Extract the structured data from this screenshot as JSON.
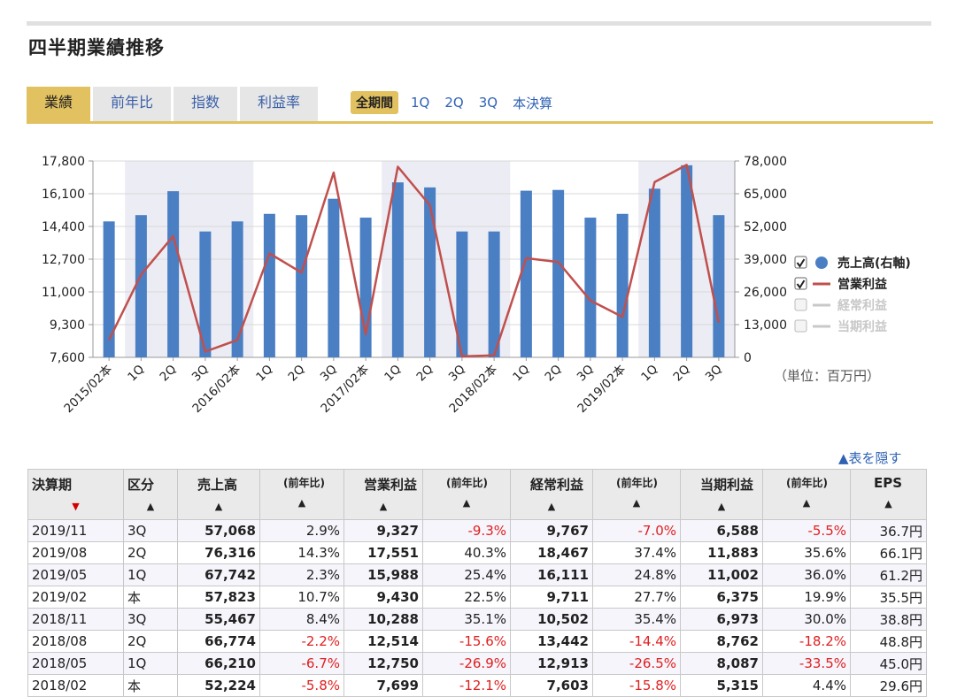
{
  "title": "四半期業績推移",
  "tabs": [
    {
      "label": "業績",
      "active": true
    },
    {
      "label": "前年比",
      "active": false
    },
    {
      "label": "指数",
      "active": false
    },
    {
      "label": "利益率",
      "active": false
    }
  ],
  "periods": [
    {
      "label": "全期間",
      "active": true
    },
    {
      "label": "1Q",
      "active": false
    },
    {
      "label": "2Q",
      "active": false
    },
    {
      "label": "3Q",
      "active": false
    },
    {
      "label": "本決算",
      "active": false
    }
  ],
  "colors": {
    "bar": "#4a7fc4",
    "line": "#c0504d",
    "band": "#ececf4",
    "gold": "#e2c160",
    "disabled": "#c8c8c8"
  },
  "chart_data": {
    "type": "bar",
    "categories": [
      "2015/02本",
      "1Q",
      "2Q",
      "3Q",
      "2016/02本",
      "1Q",
      "2Q",
      "3Q",
      "2017/02本",
      "1Q",
      "2Q",
      "3Q",
      "2018/02本",
      "1Q",
      "2Q",
      "3Q",
      "2019/02本",
      "1Q",
      "2Q",
      "3Q"
    ],
    "series": [
      {
        "name": "売上高(右軸)",
        "kind": "bar",
        "axis": "right",
        "checked": true,
        "values": [
          54000,
          56500,
          66000,
          50000,
          54000,
          57000,
          56500,
          63000,
          55500,
          69500,
          67500,
          50000,
          50000,
          66200,
          66500,
          55500,
          57000,
          67000,
          76300,
          56500
        ]
      },
      {
        "name": "営業利益",
        "kind": "line",
        "axis": "left",
        "checked": true,
        "values": [
          8500,
          11900,
          13900,
          7900,
          8500,
          13000,
          12000,
          17200,
          8800,
          17500,
          15500,
          7650,
          7700,
          12750,
          12550,
          10550,
          9700,
          16700,
          17600,
          9400
        ]
      },
      {
        "name": "経常利益",
        "kind": "line",
        "axis": "left",
        "checked": false,
        "values": []
      },
      {
        "name": "当期利益",
        "kind": "line",
        "axis": "left",
        "checked": false,
        "values": []
      }
    ],
    "left_ticks": [
      "17,800",
      "16,100",
      "14,400",
      "12,700",
      "11,000",
      "9,300",
      "7,600"
    ],
    "right_ticks": [
      "78,000",
      "65,000",
      "52,000",
      "39,000",
      "26,000",
      "13,000",
      "0"
    ],
    "ylim_left": [
      7600,
      17800
    ],
    "ylim_right": [
      0,
      78000
    ],
    "band_ranges": [
      [
        1,
        4
      ],
      [
        9,
        12
      ],
      [
        17,
        19
      ]
    ],
    "legend_placement": "right",
    "unit_label": "（単位：百万円）"
  },
  "hide_table_label": "▲表を隠す",
  "table": {
    "headers": [
      {
        "label": "決算期",
        "arrow": "▼",
        "sel": true
      },
      {
        "label": "区分",
        "arrow": "▲"
      },
      {
        "label": "売上高",
        "arrow": "▲"
      },
      {
        "label": "(前年比)",
        "arrow": "▲",
        "sub": true
      },
      {
        "label": "営業利益",
        "arrow": "▲"
      },
      {
        "label": "(前年比)",
        "arrow": "▲",
        "sub": true
      },
      {
        "label": "経常利益",
        "arrow": "▲"
      },
      {
        "label": "(前年比)",
        "arrow": "▲",
        "sub": true
      },
      {
        "label": "当期利益",
        "arrow": "▲"
      },
      {
        "label": "(前年比)",
        "arrow": "▲",
        "sub": true
      },
      {
        "label": "EPS",
        "arrow": "▲"
      }
    ],
    "rows": [
      [
        "2019/11",
        "3Q",
        "57,068",
        "2.9%",
        "9,327",
        "-9.3%",
        "9,767",
        "-7.0%",
        "6,588",
        "-5.5%",
        "36.7円"
      ],
      [
        "2019/08",
        "2Q",
        "76,316",
        "14.3%",
        "17,551",
        "40.3%",
        "18,467",
        "37.4%",
        "11,883",
        "35.6%",
        "66.1円"
      ],
      [
        "2019/05",
        "1Q",
        "67,742",
        "2.3%",
        "15,988",
        "25.4%",
        "16,111",
        "24.8%",
        "11,002",
        "36.0%",
        "61.2円"
      ],
      [
        "2019/02",
        "本",
        "57,823",
        "10.7%",
        "9,430",
        "22.5%",
        "9,711",
        "27.7%",
        "6,375",
        "19.9%",
        "35.5円"
      ],
      [
        "2018/11",
        "3Q",
        "55,467",
        "8.4%",
        "10,288",
        "35.1%",
        "10,502",
        "35.4%",
        "6,973",
        "30.0%",
        "38.8円"
      ],
      [
        "2018/08",
        "2Q",
        "66,774",
        "-2.2%",
        "12,514",
        "-15.6%",
        "13,442",
        "-14.4%",
        "8,762",
        "-18.2%",
        "48.8円"
      ],
      [
        "2018/05",
        "1Q",
        "66,210",
        "-6.7%",
        "12,750",
        "-26.9%",
        "12,913",
        "-26.5%",
        "8,087",
        "-33.5%",
        "45.0円"
      ],
      [
        "2018/02",
        "本",
        "52,224",
        "-5.8%",
        "7,699",
        "-12.1%",
        "7,603",
        "-15.8%",
        "5,315",
        "4.4%",
        "29.6円"
      ]
    ]
  }
}
